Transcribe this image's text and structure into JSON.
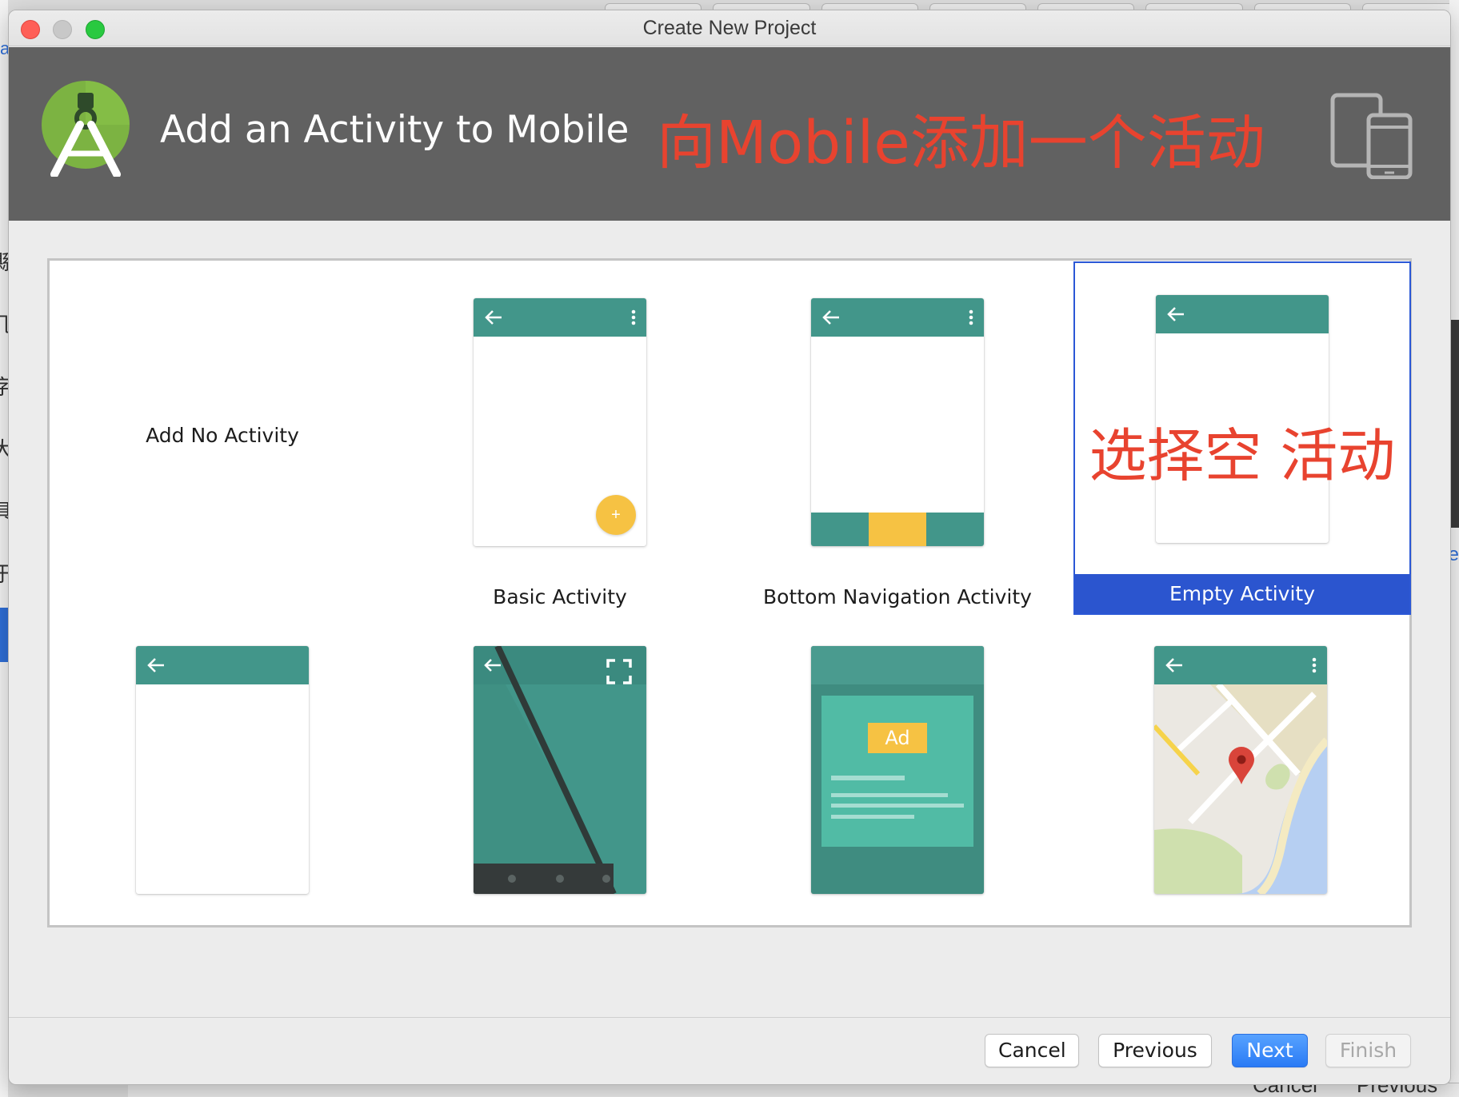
{
  "window": {
    "title": "Create New Project"
  },
  "header": {
    "title": "Add an Activity to Mobile",
    "annotation": "向Mobile添加一个活动"
  },
  "gallery": {
    "tiles": [
      {
        "label": "Add No Activity",
        "selected": false
      },
      {
        "label": "Basic Activity",
        "selected": false
      },
      {
        "label": "Bottom Navigation Activity",
        "selected": false
      },
      {
        "label": "Empty Activity",
        "selected": true,
        "annotation": "选择空 活动"
      },
      {
        "label": "",
        "preview": "fullscreen-appbar-only"
      },
      {
        "label": "",
        "preview": "fullscreen-activity"
      },
      {
        "label": "",
        "preview": "ad-activity",
        "badge": "Ad"
      },
      {
        "label": "",
        "preview": "maps-activity"
      }
    ]
  },
  "footer": {
    "cancel": "Cancel",
    "previous": "Previous",
    "next": "Next",
    "finish": "Finish"
  },
  "background": {
    "left_glyphs": [
      "縣",
      "几",
      "字",
      "大",
      "具",
      "于"
    ],
    "left_link": "a",
    "right_link": "e",
    "bottom_buttons": [
      "Cancel",
      "Previous"
    ]
  },
  "colors": {
    "header_bg": "#616161",
    "appbar_teal": "#42968a",
    "fab_yellow": "#f6c243",
    "selection_blue": "#2b55cf",
    "annotation_red": "#e8432f",
    "primary_button": "#2a7bf5"
  },
  "icons": {
    "logo": "android-studio-logo-icon",
    "device": "phone-tablet-icon",
    "back": "back-arrow-icon",
    "menu": "overflow-menu-icon",
    "fab": "plus-icon",
    "fullscreen": "fullscreen-icon",
    "map_pin": "map-pin-icon"
  }
}
